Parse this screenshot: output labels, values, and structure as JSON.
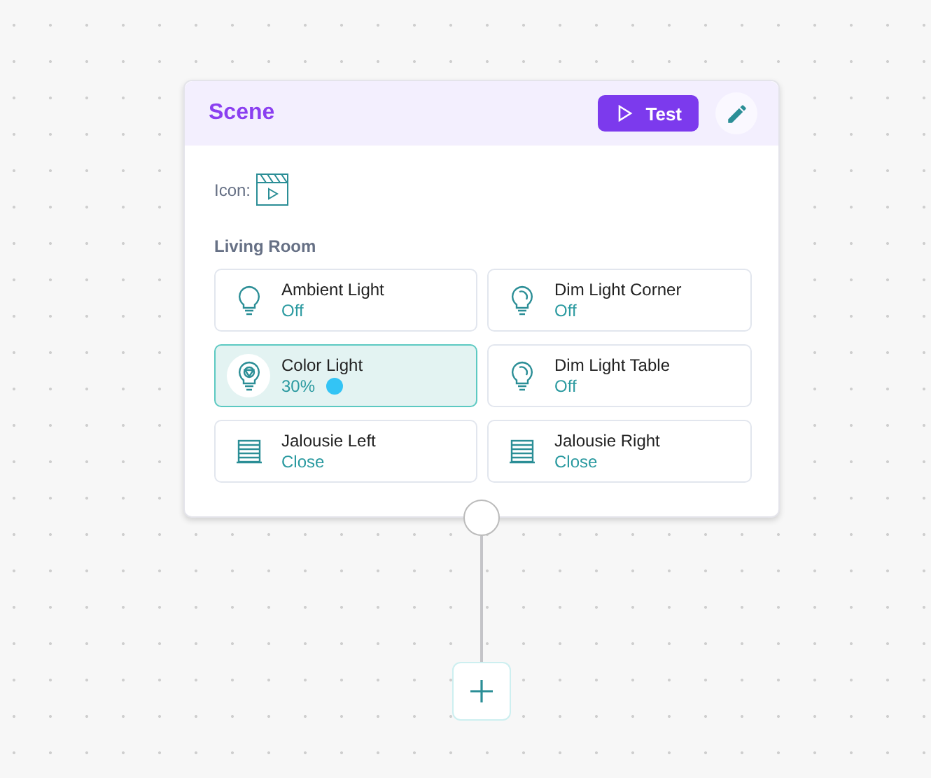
{
  "node": {
    "title": "Scene",
    "test_button": "Test",
    "icon_label": "Icon:",
    "room": "Living Room",
    "devices": [
      {
        "kind": "bulb",
        "name": "Ambient Light",
        "state": "Off",
        "selected": false
      },
      {
        "kind": "dimmer",
        "name": "Dim Light Corner",
        "state": "Off",
        "selected": false
      },
      {
        "kind": "color",
        "name": "Color Light",
        "state": "30%",
        "selected": true,
        "color": "#33c4f5"
      },
      {
        "kind": "dimmer",
        "name": "Dim Light Table",
        "state": "Off",
        "selected": false
      },
      {
        "kind": "blind",
        "name": "Jalousie Left",
        "state": "Close",
        "selected": false
      },
      {
        "kind": "blind",
        "name": "Jalousie Right",
        "state": "Close",
        "selected": false
      }
    ]
  }
}
